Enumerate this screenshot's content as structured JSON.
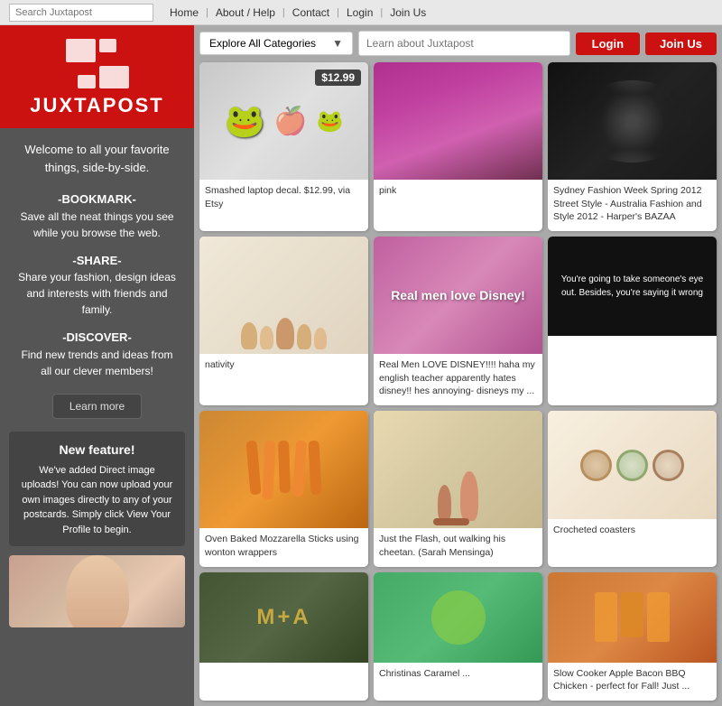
{
  "topbar": {
    "search_placeholder": "Search Juxtapost",
    "nav_items": [
      "Home",
      "About / Help",
      "Contact",
      "Login",
      "Join Us"
    ]
  },
  "content_nav": {
    "categories_label": "Explore All Categories",
    "learn_placeholder": "Learn about Juxtapost",
    "login_label": "Login",
    "joinus_label": "Join Us"
  },
  "sidebar": {
    "logo_text": "JUXTAPOST",
    "welcome_text": "Welcome to all your favorite things, side-by-side.",
    "bookmark_title": "-BOOKMARK-",
    "bookmark_desc": "Save all the neat things you see while you browse the web.",
    "share_title": "-SHARE-",
    "share_desc": "Share your fashion, design ideas and interests with friends and family.",
    "discover_title": "-DISCOVER-",
    "discover_desc": "Find new trends and ideas from all our clever members!",
    "learn_more_label": "Learn more",
    "new_feature_title": "New feature!",
    "new_feature_desc": "We've added Direct image uploads! You can now upload your own images directly to any of your postcards. Simply click View Your Profile to begin."
  },
  "posts": [
    {
      "id": "laptop-decal",
      "type": "laptop",
      "caption": "Smashed laptop decal. $12.99, via Etsy",
      "price": "$12.99"
    },
    {
      "id": "pink-hair",
      "type": "pink-hair",
      "caption": "pink",
      "price": null
    },
    {
      "id": "fashion-week",
      "type": "fashion",
      "caption": "Sydney Fashion Week Spring 2012 Street Style - Australia Fashion and Style 2012 - Harper's BAZAA",
      "price": null
    },
    {
      "id": "nativity",
      "type": "nativity",
      "caption": "nativity",
      "price": null
    },
    {
      "id": "disney",
      "type": "disney",
      "caption": "Real Men LOVE DISNEY!!!! haha my english teacher apparently hates disney!! hes annoying- disneys my ...",
      "overlay_text": "Real men love Disney!",
      "price": null
    },
    {
      "id": "movie",
      "type": "movie",
      "caption": "",
      "overlay_text": "You're going to take someone's eye out. Besides, you're saying it wrong",
      "price": null
    },
    {
      "id": "mozzarella",
      "type": "mozzarella",
      "caption": "Oven Baked Mozzarella Sticks using wonton wrappers",
      "price": null
    },
    {
      "id": "flash",
      "type": "flash",
      "caption": "Just the Flash, out walking his cheetan. (Sarah Mensinga)",
      "price": null
    },
    {
      "id": "crochet",
      "type": "crochet",
      "caption": "Crocheted coasters",
      "price": null
    },
    {
      "id": "ma",
      "type": "ma",
      "caption": "",
      "price": null
    },
    {
      "id": "caramel",
      "type": "caramel",
      "caption": "Christinas Caramel ...",
      "price": null
    },
    {
      "id": "bbq",
      "type": "bbq",
      "caption": "Slow Cooker Apple Bacon BBQ Chicken - perfect for Fall! Just ...",
      "price": null
    }
  ]
}
